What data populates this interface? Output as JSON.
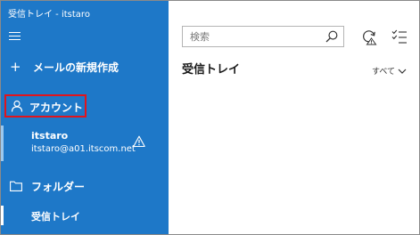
{
  "window": {
    "title": "受信トレイ - itstaro"
  },
  "sidebar": {
    "menu_icon": "hamburger-icon",
    "new_mail": {
      "icon": "plus-icon",
      "label": "メールの新規作成"
    },
    "accounts_header": {
      "icon": "person-icon",
      "label": "アカウント"
    },
    "account": {
      "name": "itstaro",
      "email": "itstaro@a01.itscom.net",
      "status_icon": "warning-icon"
    },
    "folders_header": {
      "icon": "folder-icon",
      "label": "フォルダー"
    },
    "folders": [
      {
        "label": "受信トレイ"
      }
    ]
  },
  "main": {
    "search": {
      "placeholder": "検索",
      "value": "",
      "icon": "search-icon"
    },
    "toolbar": {
      "sync_icon": "sync-icon",
      "selection_icon": "select-mode-icon"
    },
    "title": "受信トレイ",
    "filter": {
      "label": "すべて",
      "icon": "chevron-down-icon"
    }
  },
  "colors": {
    "sidebar_background": "#1e78c8",
    "highlight_border": "#e2141c",
    "text_on_sidebar": "#ffffff"
  }
}
